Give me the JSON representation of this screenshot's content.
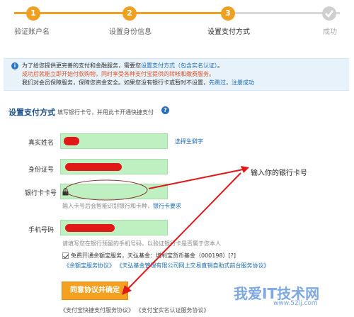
{
  "steps": [
    {
      "number": "1",
      "label": "验证账户名"
    },
    {
      "number": "2",
      "label": "设置身份信息"
    },
    {
      "number": "3",
      "label": "设置支付方式"
    },
    {
      "number": "",
      "label": "成功"
    }
  ],
  "notice": {
    "line1_prefix": "为了给您提供更完善的支付和金融服务，需要您",
    "line1_link": "设置支付方式（包含实名认证）",
    "line1_suffix": "。",
    "line2": "成功后就能立即开始付款购物，同时享受各种支付宝提供的转帐和缴费服务。",
    "line3_prefix": "我们对会员保障服务，保障您资金安全。如果您没有银行卡或暂时不设置，",
    "line3_link": "先跳过",
    "line3_sep": "，",
    "line3_link2": "注册成功"
  },
  "section": {
    "title": "设置支付方式",
    "hint": "填写银行卡号，并用此卡开通快捷支付"
  },
  "form": {
    "name_label": "真实姓名",
    "name_link": "选择生僻字",
    "id_label": "身份证号",
    "card_label": "银行卡卡号",
    "card_hint_prefix": "输入卡号后会智能识别银行和卡种，",
    "card_hint_link": "银行卡要求",
    "phone_label": "手机号码",
    "phone_hint": "请填写您在银行预留的手机号码，以验证银行卡是否属于您本人"
  },
  "agreement": {
    "text": "免费开通余额宝服务，天弘基金：增利宝货币基金（000198）[?]",
    "link1": "《余额宝服务协议》",
    "link2": "《天弘基金管理有限公司网上交易直销自助式前台服务协议》"
  },
  "submit_label": "同意协议并确定",
  "bottom_links": [
    "《支付宝快捷支付服务协议》",
    "《支付宝实名认证服务协议》"
  ],
  "annotation": "输入你的银行卡号",
  "watermark": {
    "main": "我爱IT技术网",
    "sub": "www.52ij.com"
  },
  "colors": {
    "accent": "#f0a020",
    "field": "#bff0c2",
    "redact": "#e01818",
    "link": "#1a6cb6"
  }
}
